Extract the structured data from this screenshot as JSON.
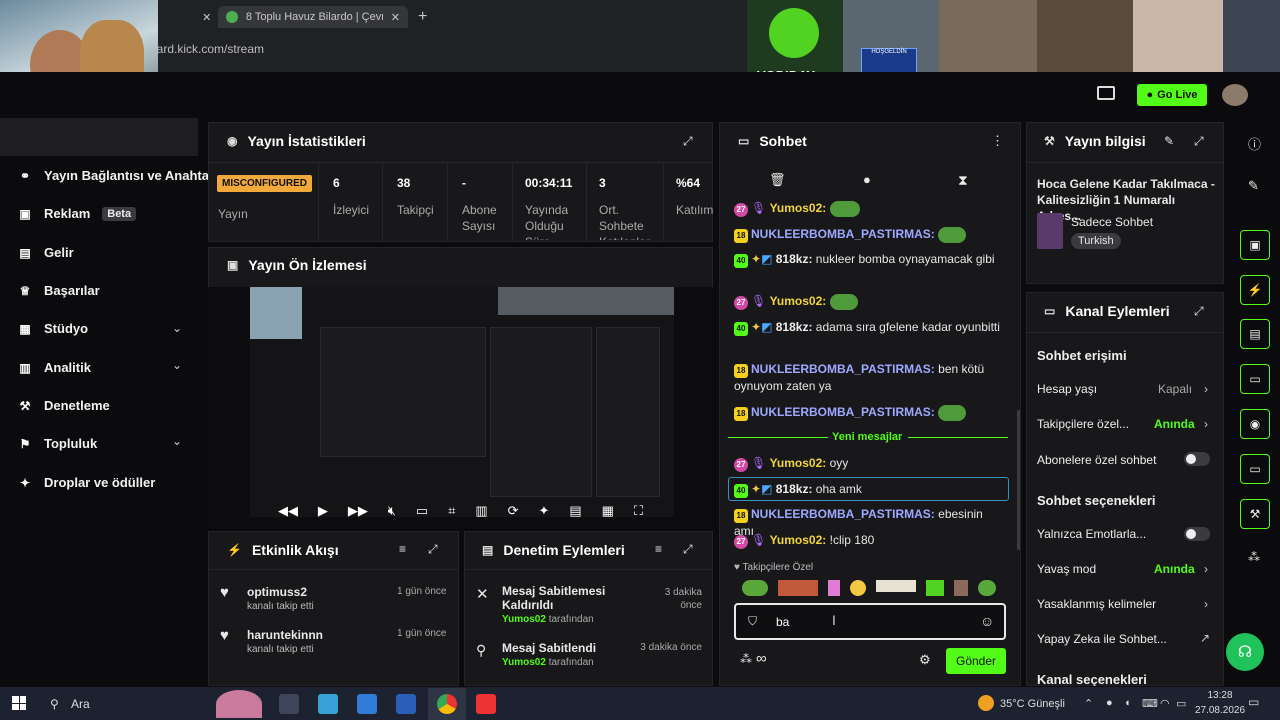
{
  "browser": {
    "tab1_title": "d",
    "tab2_title": "8 Toplu Havuz Bilardo | Çevrim...",
    "url": "oard.kick.com/stream"
  },
  "cams": {
    "vodiday": "VODIDAY",
    "sign": "HOŞGELDİN"
  },
  "header": {
    "go_live": "Go Live"
  },
  "sidebar": {
    "items": [
      {
        "label": "Yayın Bağlantısı ve Anahtar",
        "icon": "link-icon"
      },
      {
        "label": "Reklam",
        "badge": "Beta",
        "icon": "ad-icon"
      },
      {
        "label": "Gelir",
        "icon": "chart-icon"
      },
      {
        "label": "Başarılar",
        "icon": "trophy-icon"
      },
      {
        "label": "Stüdyo",
        "icon": "studio-icon"
      },
      {
        "label": "Analitik",
        "icon": "analytics-icon"
      },
      {
        "label": "Denetleme",
        "icon": "wrench-icon"
      },
      {
        "label": "Topluluk",
        "icon": "community-icon"
      },
      {
        "label": "Droplar ve ödüller",
        "icon": "gift-icon"
      }
    ]
  },
  "stats": {
    "title": "Yayın İstatistikleri",
    "status_badge": "MISCONFIGURED",
    "status_label": "Yayın",
    "cols": [
      {
        "value": "6",
        "label": "İzleyici"
      },
      {
        "value": "38",
        "label": "Takipçi"
      },
      {
        "value": "-",
        "label": "Abone Sayısı"
      },
      {
        "value": "00:34:11",
        "label": "Yayında Olduğu Süre"
      },
      {
        "value": "3",
        "label": "Ort. Sohbete Katılanlar"
      },
      {
        "value": "%64",
        "label": "Katılım"
      }
    ]
  },
  "preview": {
    "title": "Yayın Ön İzlemesi"
  },
  "activity": {
    "title": "Etkinlik Akışı",
    "items": [
      {
        "user": "optimuss2",
        "action": "kanalı takip etti",
        "time": "1 gün önce"
      },
      {
        "user": "haruntekinnn",
        "action": "kanalı takip etti",
        "time": "1 gün önce"
      }
    ]
  },
  "moderation": {
    "title": "Denetim Eylemleri",
    "items": [
      {
        "action": "Mesaj Sabitlemesi Kaldırıldı",
        "by_user": "Yumos02",
        "by_text": "tarafından",
        "time": "3 dakika önce"
      },
      {
        "action": "Mesaj Sabitlendi",
        "by_user": "Yumos02",
        "by_text": "tarafından",
        "time": "3 dakika önce"
      }
    ]
  },
  "chat": {
    "title": "Sohbet",
    "new_messages": "Yeni mesajlar",
    "messages": [
      {
        "level": "27",
        "user": "Yumos02",
        "text": ""
      },
      {
        "level": "18",
        "user": "NUKLEERBOMBA_PASTIRMAS",
        "text": ""
      },
      {
        "level": "40",
        "user": "818kz",
        "text": "nukleer bomba oynayamacak gibi"
      },
      {
        "level": "27",
        "user": "Yumos02",
        "text": ""
      },
      {
        "level": "40",
        "user": "818kz",
        "text": "adama sıra gfelene kadar oyunbitti"
      },
      {
        "level": "18",
        "user": "NUKLEERBOMBA_PASTIRMAS",
        "text": "ben kötü oynuyom zaten ya"
      },
      {
        "level": "18",
        "user": "NUKLEERBOMBA_PASTIRMAS",
        "text": ""
      },
      {
        "level": "27",
        "user": "Yumos02",
        "text": "oyy"
      },
      {
        "level": "40",
        "user": "818kz",
        "text": "oha amk"
      },
      {
        "level": "18",
        "user": "NUKLEERBOMBA_PASTIRMAS",
        "text": "ebesinin amı"
      },
      {
        "level": "27",
        "user": "Yumos02",
        "text": "!clip 180"
      }
    ],
    "followers_only": "Takipçilere Özel",
    "input_value": "ba",
    "send_label": "Gönder"
  },
  "stream_info": {
    "title": "Yayın bilgisi",
    "stream_title": "Hoca Gelene Kadar Takılmaca - Kalitesizliğin 1 Numaralı Adres...",
    "category": "Sadece Sohbet",
    "language": "Turkish"
  },
  "channel_actions": {
    "title": "Kanal Eylemleri",
    "chat_access": "Sohbet erişimi",
    "account_age": "Hesap yaşı",
    "account_age_val": "Kapalı",
    "followers_only": "Takipçilere özel...",
    "followers_only_val": "Anında",
    "subs_only": "Abonelere özel sohbet",
    "chat_options": "Sohbet seçenekleri",
    "emotes_only": "Yalnızca Emotlarla...",
    "slow_mode": "Yavaş mod",
    "slow_mode_val": "Anında",
    "banned_words": "Yasaklanmış kelimeler",
    "ai_chat": "Yapay Zeka ile Sohbet...",
    "channel_settings": "Kanal seçenekleri"
  },
  "taskbar": {
    "search": "Ara",
    "weather": "35°C Güneşli",
    "time": "13:28",
    "date": "27.08.2026"
  },
  "colors": {
    "accent": "#53fc18",
    "misconfigured": "#f2a93b"
  }
}
